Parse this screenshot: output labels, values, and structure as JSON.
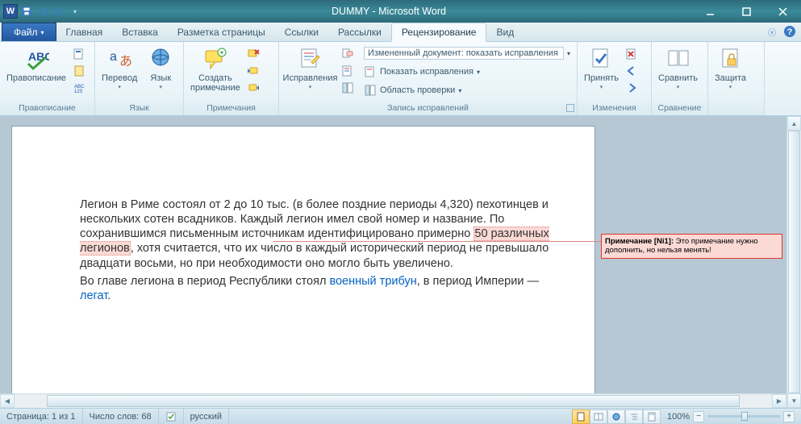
{
  "title": "DUMMY - Microsoft Word",
  "tabs": {
    "file": "Файл",
    "items": [
      "Главная",
      "Вставка",
      "Разметка страницы",
      "Ссылки",
      "Рассылки",
      "Рецензирование",
      "Вид"
    ],
    "active": 5
  },
  "ribbon": {
    "g0": {
      "label": "Правописание",
      "btn_spelling": "Правописание"
    },
    "g1": {
      "label": "Язык",
      "btn_translate": "Перевод",
      "btn_language": "Язык"
    },
    "g2": {
      "label": "Примечания",
      "btn_newcomment": "Создать\nпримечание"
    },
    "g3": {
      "label": "Запись исправлений",
      "btn_track": "Исправления",
      "dd_display": "Измененный документ: показать исправления",
      "dd_showmarkup": "Показать исправления",
      "dd_reviewpane": "Область проверки"
    },
    "g4": {
      "label": "Изменения",
      "btn_accept": "Принять"
    },
    "g5": {
      "label": "Сравнение",
      "btn_compare": "Сравнить"
    },
    "g6": {
      "label": " ",
      "btn_protect": "Защита"
    }
  },
  "document": {
    "p1_a": "Легион в Риме состоял от 2 до 10 тыс. (в более поздние периоды 4,320) пехотинцев и нескольких сотен всадников. Каждый легион имел свой номер и название. По сохранившимся письменным источникам идентифицировано примерно ",
    "p1_hl": "50 различных легионов",
    "p1_b": ", хотя считается, что их число в каждый исторический период не превышало двадцати восьми, но при необходимости оно могло быть увеличено.",
    "p2_a": "Во главе легиона в период Республики стоял ",
    "p2_link1": "военный трибун",
    "p2_b": ", в период Империи — ",
    "p2_link2": "легат",
    "p2_c": "."
  },
  "comment": {
    "label": "Примечание [Ni1]:",
    "text": " Это примечание нужно дополнить, но нельзя менять!"
  },
  "status": {
    "page": "Страница: 1 из 1",
    "words": "Число слов: 68",
    "lang": "русский",
    "zoom": "100%",
    "minus": "−",
    "plus": "+"
  }
}
